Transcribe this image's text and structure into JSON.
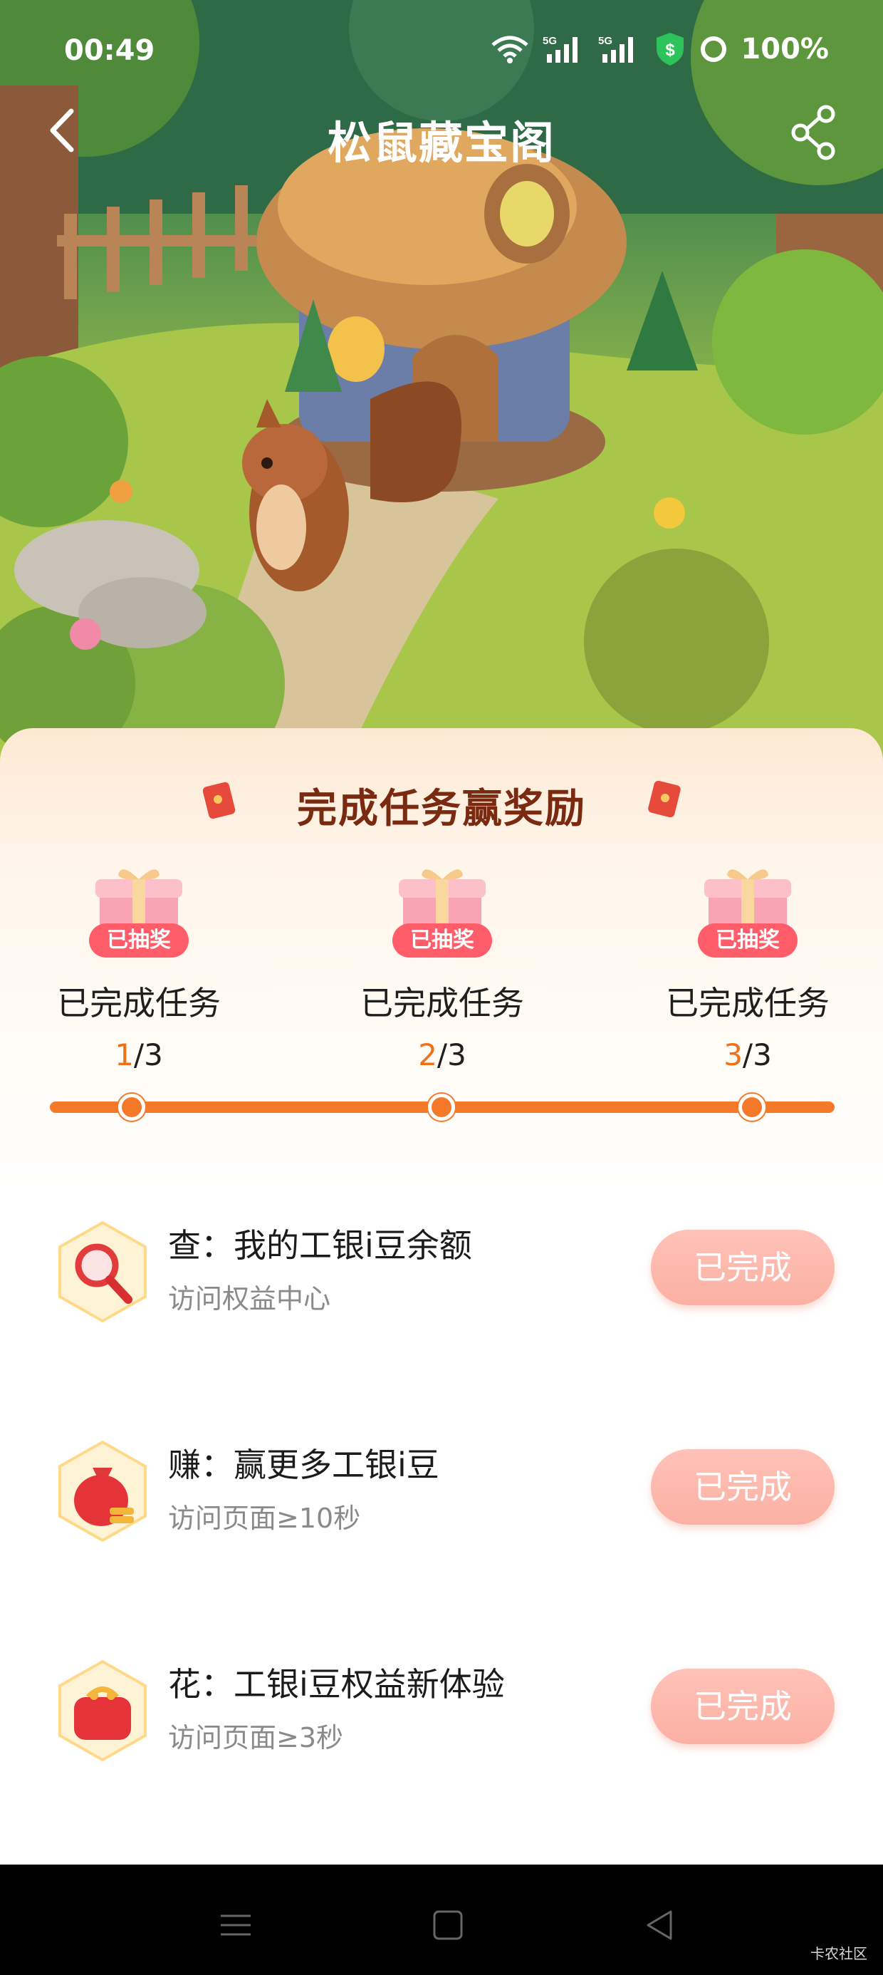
{
  "status_bar": {
    "time": "00:49",
    "network_1": "5G",
    "network_2": "5G",
    "battery": "100%"
  },
  "nav": {
    "title": "松鼠藏宝阁"
  },
  "rewards": {
    "title": "完成任务赢奖励",
    "milestones": [
      {
        "badge": "已抽奖",
        "label": "已完成任务",
        "current": "1",
        "total": "/3"
      },
      {
        "badge": "已抽奖",
        "label": "已完成任务",
        "current": "2",
        "total": "/3"
      },
      {
        "badge": "已抽奖",
        "label": "已完成任务",
        "current": "3",
        "total": "/3"
      }
    ],
    "progress_fraction": 1.0
  },
  "tasks": [
    {
      "icon": "magnifier-icon",
      "title": "查：我的工银i豆余额",
      "subtitle": "访问权益中心",
      "button": "已完成"
    },
    {
      "icon": "money-bag-icon",
      "title": "赚：赢更多工银i豆",
      "subtitle": "访问页面≥10秒",
      "button": "已完成"
    },
    {
      "icon": "coin-purse-icon",
      "title": "花：工银i豆权益新体验",
      "subtitle": "访问页面≥3秒",
      "button": "已完成"
    }
  ],
  "watermark": "卡农社区",
  "colors": {
    "accent_orange": "#f47a2a",
    "done_button": "#fbb0a3",
    "title_brown": "#7a2a10",
    "badge_red": "#ff5d6a"
  }
}
